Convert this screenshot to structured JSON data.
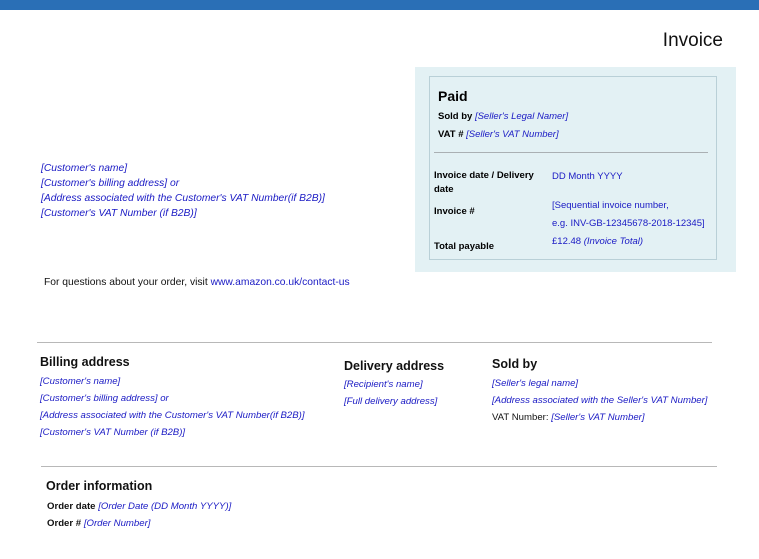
{
  "header": {
    "title": "Invoice"
  },
  "customer_block": [
    "[Customer's name]",
    "[Customer's billing address] or",
    "[Address associated with the Customer's VAT Number(if B2B)]",
    "[Customer's VAT Number (if B2B)]"
  ],
  "questions": {
    "text": "For questions about your order, visit ",
    "link": "www.amazon.co.uk/contact-us"
  },
  "paid_box": {
    "title": "Paid",
    "sold_by_label": "Sold by",
    "sold_by_value": "[Seller's Legal Namer]",
    "vat_label": "VAT #",
    "vat_value": "[Seller's VAT Number]",
    "invoice_date_label_1": "Invoice date / Delivery",
    "invoice_date_label_2": "date",
    "invoice_date_value": "DD Month YYYY",
    "invoice_no_label": "Invoice #",
    "invoice_no_value_1": "[Sequential invoice number,",
    "invoice_no_value_2": "e.g. INV-GB-12345678-2018-12345]",
    "total_label": "Total payable",
    "total_amount": "£12.48",
    "total_note": "(Invoice Total)"
  },
  "billing": {
    "heading": "Billing address",
    "lines": [
      "[Customer's name]",
      "[Customer's billing address] or",
      "[Address associated with the Customer's VAT Number(if B2B)]",
      "[Customer's VAT Number (if B2B)]"
    ]
  },
  "delivery": {
    "heading": "Delivery address",
    "lines": [
      "[Recipient's name]",
      "[Full delivery address]"
    ]
  },
  "sold_by": {
    "heading": "Sold by",
    "lines": [
      "[Seller's legal name]",
      "[Address associated with the Seller's VAT Number]"
    ],
    "vat_label": "VAT Number:",
    "vat_value": "[Seller's VAT Number]"
  },
  "order_info": {
    "heading": "Order information",
    "date_label": "Order date",
    "date_value": "[Order Date (DD Month YYYY)]",
    "number_label": "Order #",
    "number_value": "[Order Number]"
  },
  "colors": {
    "accent": "#2a6fb6",
    "paid_bg": "#e3f1f4",
    "placeholder_text": "#1a1ac4"
  }
}
